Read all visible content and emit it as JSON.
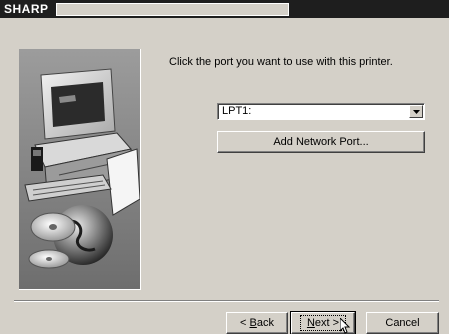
{
  "titlebar": {
    "title": "SHARP"
  },
  "main": {
    "instruction": "Click the port you want to use with this printer.",
    "port_select": {
      "value": "LPT1:"
    },
    "add_network_port_label": "Add Network Port..."
  },
  "footer": {
    "back": {
      "prefix": "< ",
      "accel": "B",
      "rest": "ack"
    },
    "next": {
      "accel": "N",
      "rest": "ext >"
    },
    "cancel_label": "Cancel"
  },
  "icons": {
    "dropdown": "chevron-down-icon",
    "artwork": "computer-and-globe-illustration",
    "cursor": "mouse-pointer-icon"
  },
  "colors": {
    "titlebar": "#1e1e1e",
    "dialog": "#d4d0c8"
  }
}
